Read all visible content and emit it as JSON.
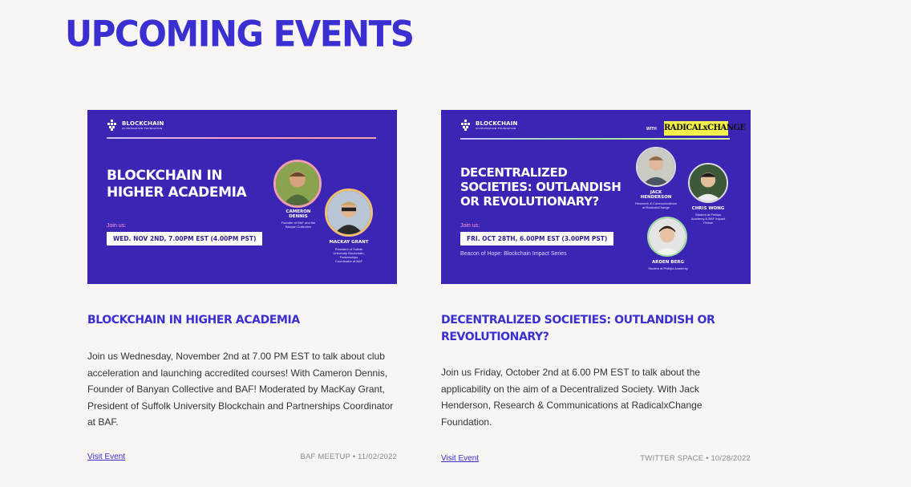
{
  "page": {
    "title": "UPCOMING EVENTS"
  },
  "events": [
    {
      "banner": {
        "logo_title": "BLOCKCHAIN",
        "logo_subtitle": "ACCELERATION FOUNDATION",
        "title_line1": "BLOCKCHAIN IN",
        "title_line2": "HIGHER ACADEMIA",
        "join_label": "Join us:",
        "date": "WED. NOV 2ND, 7.00PM EST (4.00PM PST)",
        "speakers": [
          {
            "name_line1": "CAMERON",
            "name_line2": "DENNIS",
            "role_line1": "Founder of BAF and the",
            "role_line2": "Banyan Collective"
          },
          {
            "name_line1": "MACKAY GRANT",
            "role_line1": "President of Suffolk",
            "role_line2": "University Blockchain,",
            "role_line3": "Partnerships",
            "role_line4": "Coordinator at BAF"
          }
        ]
      },
      "title": "BLOCKCHAIN IN HIGHER ACADEMIA",
      "description": "Join us Wednesday, November 2nd at 7.00 PM EST to talk about club acceleration and launching accredited courses! With Cameron Dennis, Founder of Banyan Collective and BAF! Moderated by MacKay Grant, President of Suffolk University Blockchain and Partnerships Coordinator at BAF.",
      "link_label": "Visit Event",
      "meta": "BAF MEETUP • 11/02/2022"
    },
    {
      "banner": {
        "logo_title": "BLOCKCHAIN",
        "logo_subtitle": "ACCELERATION FOUNDATION",
        "with_label": "WITH",
        "partner": "RADICALxCHANGE",
        "title_line1": "DECENTRALIZED",
        "title_line2": "SOCIETIES: OUTLANDISH",
        "title_line3": "OR REVOLUTIONARY?",
        "join_label": "Join us:",
        "date": "FRI. OCT 28TH, 6.00PM EST (3.00PM PST)",
        "series": "Beacon of Hope: Blockchain Impact Series",
        "speakers": [
          {
            "name_line1": "JACK",
            "name_line2": "HENDERSON",
            "role_line1": "Research & Communications",
            "role_line2": "at RadicalxChange"
          },
          {
            "name_line1": "CHRIS WONG",
            "role_line1": "Student at Phillips",
            "role_line2": "Academy & BAF Impact",
            "role_line3": "Fellow"
          },
          {
            "name_line1": "ARDEN BERG",
            "role_line1": "Student at Phillips Academy"
          }
        ]
      },
      "title": "DECENTRALIZED SOCIETIES: OUTLANDISH OR REVOLUTIONARY?",
      "description": "Join us Friday, October 2nd at 6.00 PM EST to talk about the applicability on the aim of a Decentralized Society. With Jack Henderson, Research & Communications at RadicalxChange Foundation.",
      "link_label": "Visit Event",
      "meta": "TWITTER SPACE • 10/28/2022"
    }
  ],
  "colors": {
    "accent": "#3a2fd1",
    "banner_bg": "#3b25b5",
    "page_bg": "#f8f5f2",
    "partner_bg": "#f3f14a"
  }
}
